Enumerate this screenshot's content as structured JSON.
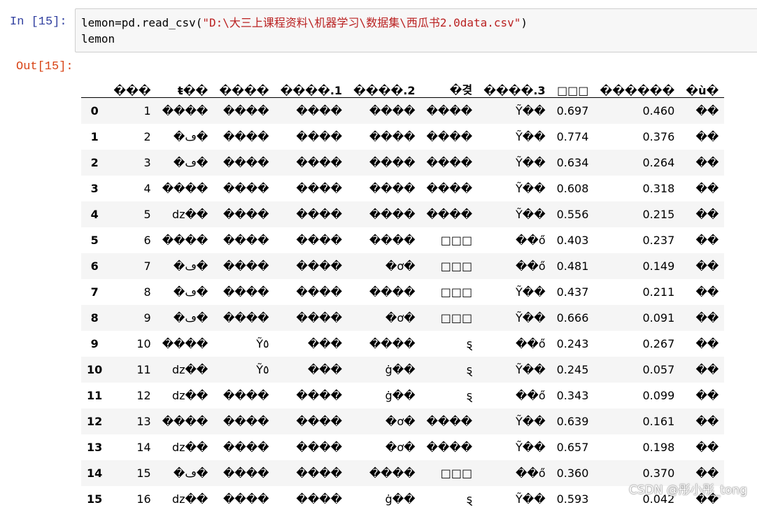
{
  "notebook": {
    "in_prompt": "In  [15]:",
    "out_prompt": "Out[15]:",
    "code_line1_pre": "lemon=pd.read_csv(",
    "code_line1_str": "\"D:\\大三上课程资料\\机器学习\\数据集\\西瓜书2.0data.csv\"",
    "code_line1_post": ")",
    "code_line2": "lemon"
  },
  "table": {
    "columns": [
      "",
      "���",
      "ŧ��",
      "����",
      "����.1",
      "����.2",
      "�겾",
      "����.3",
      "□□□",
      "������",
      "�ù�"
    ],
    "rows": [
      [
        "0",
        "1",
        "����",
        "����",
        "����",
        "����",
        "����",
        "Ỹ��",
        "0.697",
        "0.460",
        "��"
      ],
      [
        "1",
        "2",
        "�ڡ�",
        "����",
        "����",
        "����",
        "����",
        "Ỹ��",
        "0.774",
        "0.376",
        "��"
      ],
      [
        "2",
        "3",
        "�ڡ�",
        "����",
        "����",
        "����",
        "����",
        "Ỹ��",
        "0.634",
        "0.264",
        "��"
      ],
      [
        "3",
        "4",
        "����",
        "����",
        "����",
        "����",
        "����",
        "Ỹ��",
        "0.608",
        "0.318",
        "��"
      ],
      [
        "4",
        "5",
        "dz��",
        "����",
        "����",
        "����",
        "����",
        "Ỹ��",
        "0.556",
        "0.215",
        "��"
      ],
      [
        "5",
        "6",
        "����",
        "����",
        "����",
        "����",
        "□□□",
        "��ő",
        "0.403",
        "0.237",
        "��"
      ],
      [
        "6",
        "7",
        "�ڡ�",
        "����",
        "����",
        "�ơ�",
        "□□□",
        "��ő",
        "0.481",
        "0.149",
        "��"
      ],
      [
        "7",
        "8",
        "�ڡ�",
        "����",
        "����",
        "����",
        "□□□",
        "Ỹ��",
        "0.437",
        "0.211",
        "��"
      ],
      [
        "8",
        "9",
        "�ڡ�",
        "����",
        "����",
        "�ơ�",
        "□□□",
        "Ỹ��",
        "0.666",
        "0.091",
        "��"
      ],
      [
        "9",
        "10",
        "����",
        "Ỹ٥",
        "���",
        "����",
        "ȿ",
        "��ő",
        "0.243",
        "0.267",
        "��"
      ],
      [
        "10",
        "11",
        "dz��",
        "Ỹ٥",
        "���",
        "ġ��",
        "ȿ",
        "Ỹ��",
        "0.245",
        "0.057",
        "��"
      ],
      [
        "11",
        "12",
        "dz��",
        "����",
        "����",
        "ġ��",
        "ȿ",
        "��ő",
        "0.343",
        "0.099",
        "��"
      ],
      [
        "12",
        "13",
        "����",
        "����",
        "����",
        "�ơ�",
        "����",
        "Ỹ��",
        "0.639",
        "0.161",
        "��"
      ],
      [
        "13",
        "14",
        "dz��",
        "����",
        "����",
        "�ơ�",
        "����",
        "Ỹ��",
        "0.657",
        "0.198",
        "��"
      ],
      [
        "14",
        "15",
        "�ڡ�",
        "����",
        "����",
        "����",
        "□□□",
        "��ő",
        "0.360",
        "0.370",
        "��"
      ],
      [
        "15",
        "16",
        "dz��",
        "����",
        "����",
        "ġ��",
        "ȿ",
        "Ỹ��",
        "0.593",
        "0.042",
        "��"
      ]
    ]
  },
  "watermark": "CSDN @彤小彤_tong"
}
